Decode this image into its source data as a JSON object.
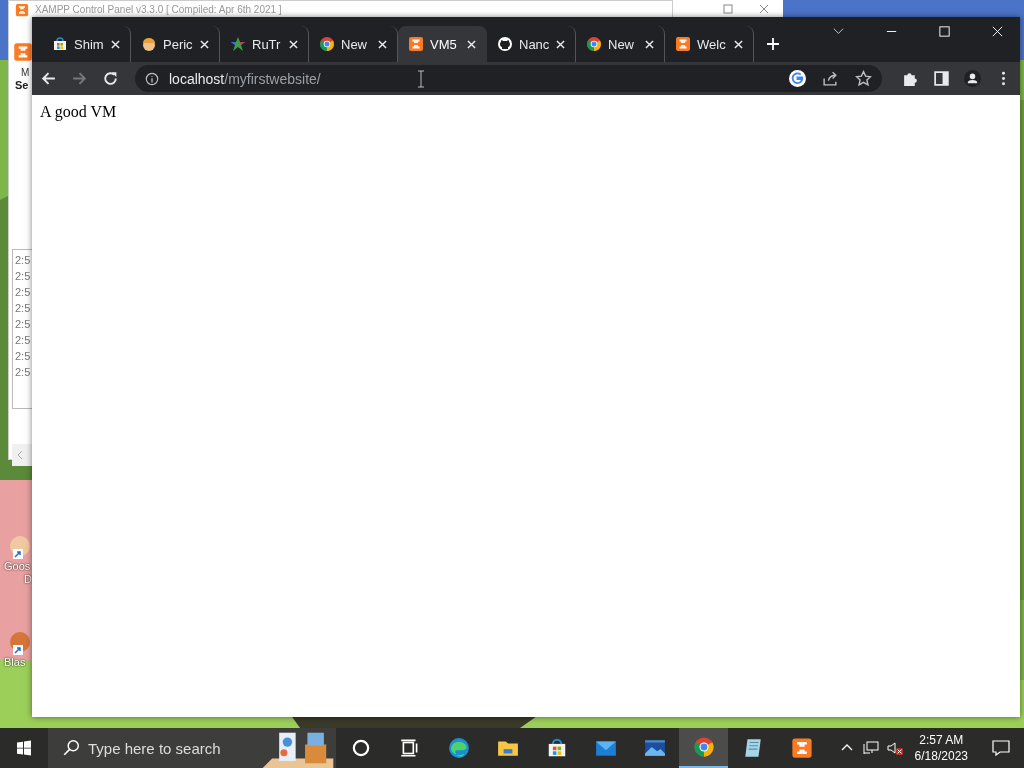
{
  "background_window": {
    "title": "XAMPP Control Panel v3.3.0   [ Compiled: Apr 6th 2021 ]",
    "fragments": [
      "M",
      "Se"
    ],
    "log_lines": [
      "2:5",
      "2:5",
      "2:5",
      "2:5",
      "2:5",
      "2:5",
      "2:5",
      "2:5"
    ]
  },
  "desktop_icons": [
    {
      "label": "Goos",
      "label_2": "D"
    },
    {
      "label": "Blas"
    }
  ],
  "browser": {
    "tabs": [
      {
        "title": "Shim",
        "kind": "store",
        "selected": false
      },
      {
        "title": "Peric",
        "kind": "avatar",
        "selected": false
      },
      {
        "title": "RuTr",
        "kind": "star",
        "selected": false
      },
      {
        "title": "New",
        "kind": "chrome",
        "selected": false
      },
      {
        "title": "VM5",
        "kind": "xampp",
        "selected": true
      },
      {
        "title": "Nanc",
        "kind": "github",
        "selected": false
      },
      {
        "title": "New",
        "kind": "chrome",
        "selected": false
      },
      {
        "title": "Welc",
        "kind": "xampp",
        "selected": false
      }
    ],
    "address": {
      "host": "localhost",
      "path": "/myfirstwebsite/"
    },
    "page_text": "A good VM"
  },
  "taskbar": {
    "search_placeholder": "Type here to search",
    "apps": [
      {
        "kind": "cortana",
        "selected": false
      },
      {
        "kind": "taskview",
        "selected": false
      },
      {
        "kind": "edge",
        "selected": false
      },
      {
        "kind": "folder",
        "selected": false
      },
      {
        "kind": "store",
        "selected": false
      },
      {
        "kind": "mail",
        "selected": false
      },
      {
        "kind": "photos",
        "selected": false
      },
      {
        "kind": "chrome",
        "selected": true
      },
      {
        "kind": "notepad",
        "selected": false
      },
      {
        "kind": "xampp",
        "selected": false
      }
    ],
    "time": "2:57 AM",
    "date": "6/18/2023"
  }
}
